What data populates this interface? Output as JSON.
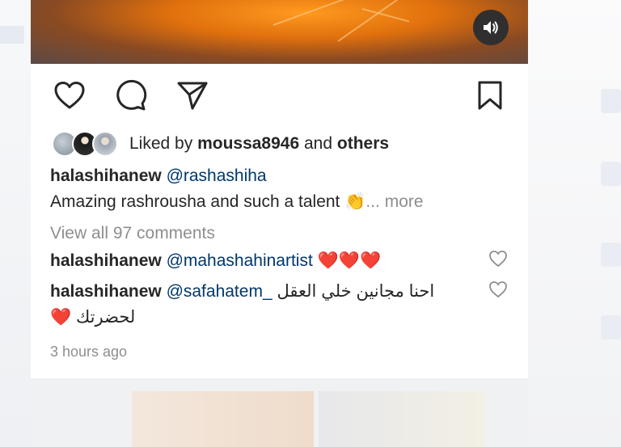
{
  "post": {
    "liked_by_prefix": "Liked by",
    "liked_by_user": "moussa8946",
    "liked_by_and": "and",
    "liked_by_others": "others",
    "caption": {
      "username": "halashihanew",
      "mention": "@rashashiha",
      "text": "Amazing rashrousha and such a talent 👏",
      "more": "... more"
    },
    "view_comments": "View all 97 comments",
    "comments": [
      {
        "username": "halashihanew",
        "mention": "@mahashahinartist",
        "text": "❤️❤️❤️"
      },
      {
        "username": "halashihanew",
        "mention": "@safahatem_",
        "text": "احنا مجانين خلي العقل",
        "text_line2": "لحضرتك ❤️"
      }
    ],
    "timestamp": "3 hours ago"
  },
  "icons": {
    "like": "heart-icon",
    "comment": "comment-bubble-icon",
    "share": "paper-plane-icon",
    "save": "bookmark-icon",
    "sound": "speaker-icon"
  },
  "colors": {
    "mention": "#00376b",
    "muted": "#8e8e8e",
    "heart_red": "#ed4956",
    "text": "#262626"
  }
}
